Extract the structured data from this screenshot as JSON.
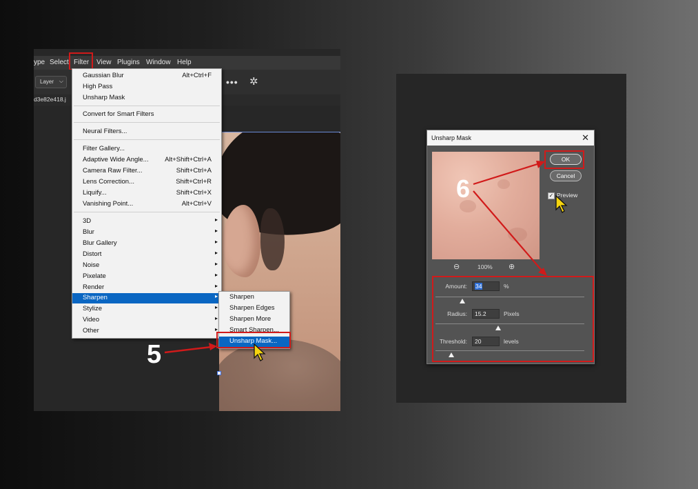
{
  "left": {
    "menubar": [
      "ype",
      "Select",
      "Filter",
      "View",
      "Plugins",
      "Window",
      "Help"
    ],
    "layer_select": "Layer",
    "doc_tab": "d3e82e418.j",
    "filter_menu": {
      "items": [
        {
          "label": "Gaussian Blur",
          "shortcut": "Alt+Ctrl+F"
        },
        {
          "label": "High Pass",
          "shortcut": ""
        },
        {
          "label": "Unsharp Mask",
          "shortcut": ""
        },
        {
          "label": "Convert for Smart Filters",
          "shortcut": ""
        },
        {
          "label": "Neural Filters...",
          "shortcut": ""
        },
        {
          "label": "Filter Gallery...",
          "shortcut": ""
        },
        {
          "label": "Adaptive Wide Angle...",
          "shortcut": "Alt+Shift+Ctrl+A"
        },
        {
          "label": "Camera Raw Filter...",
          "shortcut": "Shift+Ctrl+A"
        },
        {
          "label": "Lens Correction...",
          "shortcut": "Shift+Ctrl+R"
        },
        {
          "label": "Liquify...",
          "shortcut": "Shift+Ctrl+X"
        },
        {
          "label": "Vanishing Point...",
          "shortcut": "Alt+Ctrl+V"
        },
        {
          "label": "3D"
        },
        {
          "label": "Blur"
        },
        {
          "label": "Blur Gallery"
        },
        {
          "label": "Distort"
        },
        {
          "label": "Noise"
        },
        {
          "label": "Pixelate"
        },
        {
          "label": "Render"
        },
        {
          "label": "Sharpen"
        },
        {
          "label": "Stylize"
        },
        {
          "label": "Video"
        },
        {
          "label": "Other"
        }
      ],
      "submenu_arrow": "▸"
    },
    "sharpen_submenu": [
      "Sharpen",
      "Sharpen Edges",
      "Sharpen More",
      "Smart Sharpen...",
      "Unsharp Mask..."
    ],
    "step_label": "5"
  },
  "right": {
    "dialog": {
      "title": "Unsharp Mask",
      "close": "✕",
      "ok": "OK",
      "cancel": "Cancel",
      "preview_label": "Preview",
      "preview_checked": true,
      "zoom": "100%",
      "amount_label": "Amount:",
      "amount_value": "34",
      "amount_unit": "%",
      "radius_label": "Radius:",
      "radius_value": "15.2",
      "radius_unit": "Pixels",
      "threshold_label": "Threshold:",
      "threshold_value": "20",
      "threshold_unit": "levels"
    },
    "step_label": "6"
  },
  "colors": {
    "highlight": "#d11a1a",
    "menu_active": "#0a66c2",
    "cursor": "#f5d40f"
  }
}
